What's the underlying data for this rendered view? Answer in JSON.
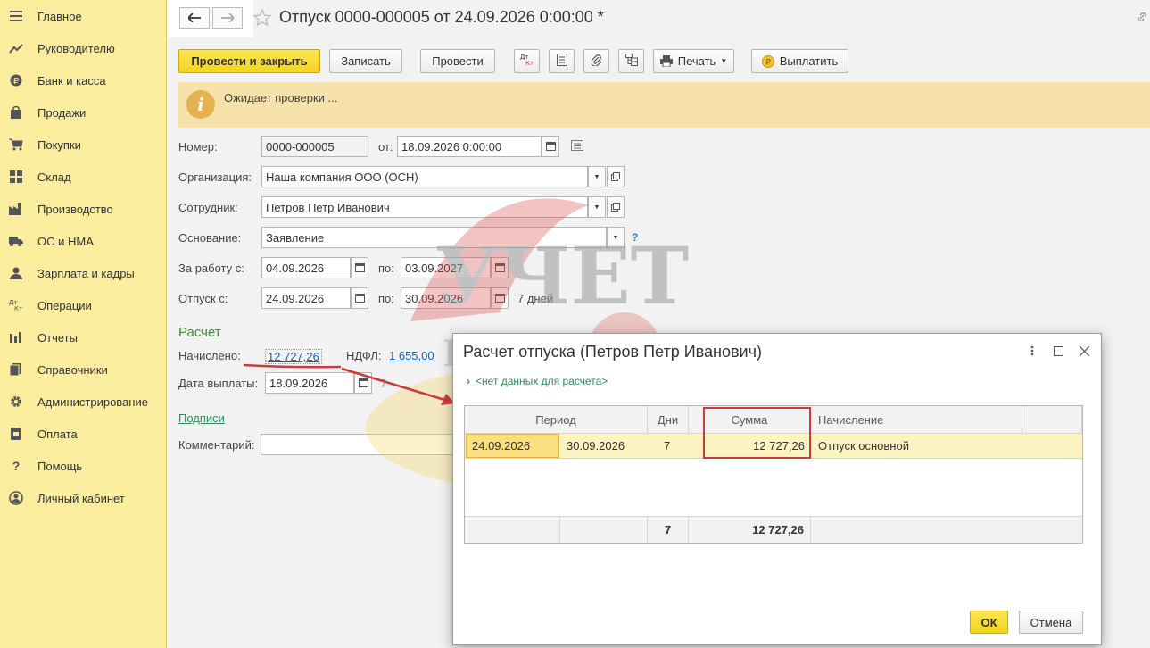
{
  "sidebar": {
    "items": [
      {
        "label": "Главное",
        "icon": "menu-icon"
      },
      {
        "label": "Руководителю",
        "icon": "trend-icon"
      },
      {
        "label": "Банк и касса",
        "icon": "ruble-coin-icon"
      },
      {
        "label": "Продажи",
        "icon": "shopping-bag-icon"
      },
      {
        "label": "Покупки",
        "icon": "cart-icon"
      },
      {
        "label": "Склад",
        "icon": "warehouse-icon"
      },
      {
        "label": "Производство",
        "icon": "factory-icon"
      },
      {
        "label": "ОС и НМА",
        "icon": "truck-icon"
      },
      {
        "label": "Зарплата и кадры",
        "icon": "person-icon"
      },
      {
        "label": "Операции",
        "icon": "dt-kt-icon"
      },
      {
        "label": "Отчеты",
        "icon": "bar-chart-icon"
      },
      {
        "label": "Справочники",
        "icon": "books-icon"
      },
      {
        "label": "Администрирование",
        "icon": "gear-icon"
      },
      {
        "label": "Оплата",
        "icon": "payment-icon"
      },
      {
        "label": "Помощь",
        "icon": "question-icon"
      },
      {
        "label": "Личный кабинет",
        "icon": "user-circle-icon"
      }
    ]
  },
  "header": {
    "title": "Отпуск 0000-000005 от 24.09.2026 0:00:00 *"
  },
  "toolbar": {
    "post_close": "Провести и закрыть",
    "save": "Записать",
    "post": "Провести",
    "dtkt_icon": "Дт Кт",
    "print": "Печать",
    "pay": "Выплатить"
  },
  "notice": {
    "text": "Ожидает проверки ..."
  },
  "form": {
    "number_label": "Номер:",
    "number": "0000-000005",
    "from_label": "от:",
    "from_date": "18.09.2026  0:00:00",
    "org_label": "Организация:",
    "org": "Наша компания ООО (ОСН)",
    "employee_label": "Сотрудник:",
    "employee": "Петров Петр Иванович",
    "basis_label": "Основание:",
    "basis": "Заявление",
    "help_mark": "?",
    "work_label": "За работу с:",
    "work_from": "04.09.2026",
    "to_label": "по:",
    "work_to": "03.09.2027",
    "vacation_label": "Отпуск с:",
    "vacation_from": "24.09.2026",
    "vacation_to": "30.09.2026",
    "days": "7 дней",
    "calc_title": "Расчет",
    "accrued_label": "Начислено:",
    "accrued": "12 727,26",
    "ndfl_label": "НДФЛ:",
    "ndfl": "1 655,00",
    "paydate_label": "Дата выплаты:",
    "paydate": "18.09.2026",
    "signatures": "Подписи",
    "comment_label": "Комментарий:",
    "comment": ""
  },
  "watermark": {
    "line1": "УЧЕТ",
    "line2": "БЕЗ ЗАБОТ"
  },
  "dialog": {
    "title": "Расчет отпуска (Петров Петр Иванович)",
    "expand": "<нет данных для расчета>",
    "columns": {
      "period": "Период",
      "days": "Дни",
      "sum": "Сумма",
      "accrual": "Начисление"
    },
    "rows": [
      {
        "from": "24.09.2026",
        "to": "30.09.2026",
        "days": "7",
        "sum": "12 727,26",
        "accrual": "Отпуск основной"
      }
    ],
    "totals": {
      "days": "7",
      "sum": "12 727,26"
    },
    "ok": "ОК",
    "cancel": "Отмена"
  },
  "colors": {
    "sidebar_bg": "#fbed9e",
    "primary_button": "#f4d41d",
    "notice_bg": "#f7e1ab",
    "selected_row": "#fcf3c2",
    "highlight_border": "#cc3b3b",
    "arrow": "#d9534f"
  }
}
